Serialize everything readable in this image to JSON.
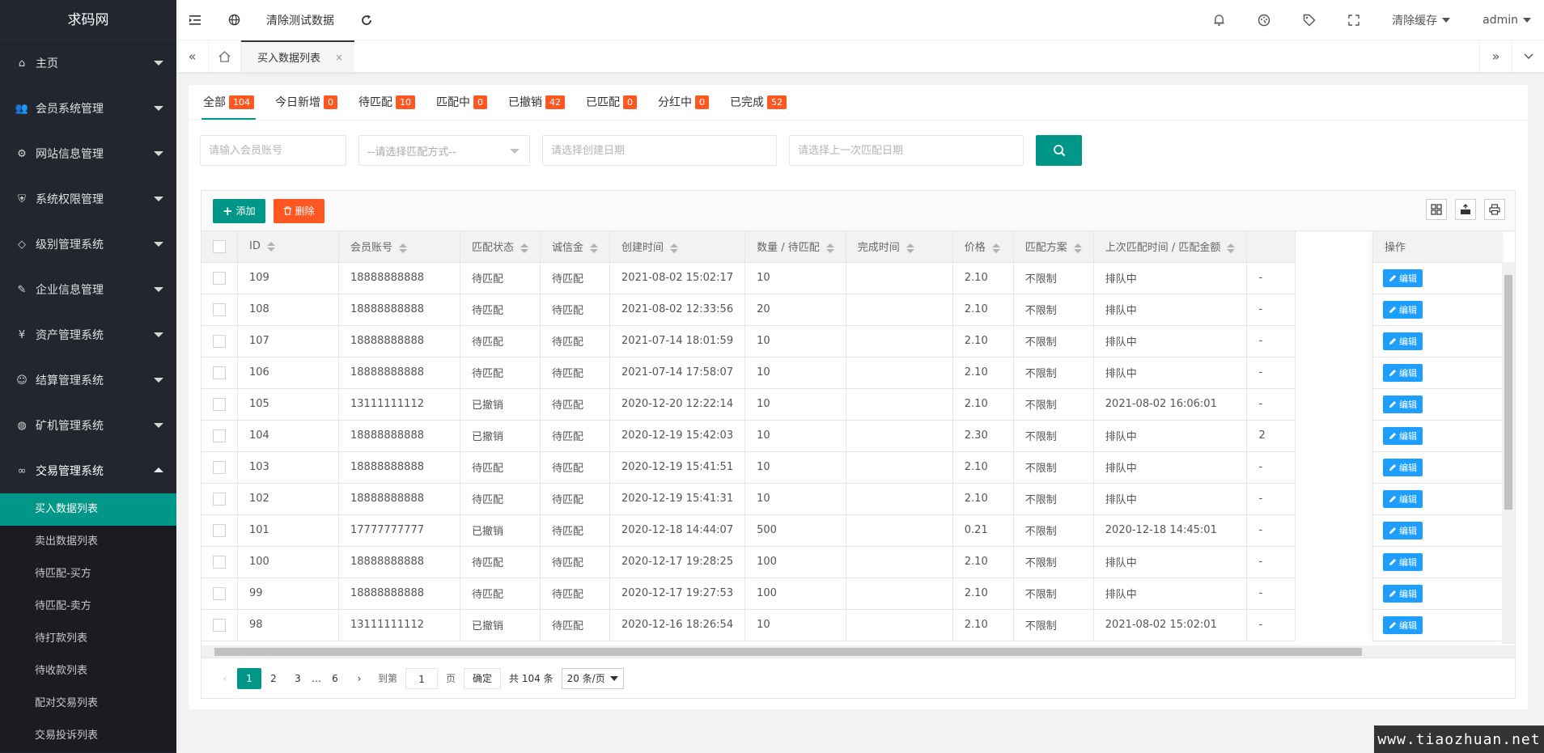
{
  "sidebar": {
    "logo": "求码网",
    "items": [
      {
        "label": "主页",
        "icon": "home-icon",
        "glyph": "⌂"
      },
      {
        "label": "会员系统管理",
        "icon": "users-icon",
        "glyph": "👥"
      },
      {
        "label": "网站信息管理",
        "icon": "gear-icon",
        "glyph": "⚙"
      },
      {
        "label": "系统权限管理",
        "icon": "shield-icon",
        "glyph": "⛨"
      },
      {
        "label": "级别管理系统",
        "icon": "diamond-icon",
        "glyph": "◇"
      },
      {
        "label": "企业信息管理",
        "icon": "file-edit-icon",
        "glyph": "✎"
      },
      {
        "label": "资产管理系统",
        "icon": "yen-icon",
        "glyph": "¥"
      },
      {
        "label": "结算管理系统",
        "icon": "smile-icon",
        "glyph": "☺"
      },
      {
        "label": "矿机管理系统",
        "icon": "globe-icon",
        "glyph": "◍"
      },
      {
        "label": "交易管理系统",
        "icon": "infinity-icon",
        "glyph": "∞"
      }
    ],
    "subitems": [
      "买入数据列表",
      "卖出数据列表",
      "待匹配-买方",
      "待匹配-卖方",
      "待打款列表",
      "待收款列表",
      "配对交易列表",
      "交易投诉列表"
    ]
  },
  "header": {
    "clear_test_data": "清除测试数据",
    "clear_cache": "清除缓存",
    "user": "admin"
  },
  "tabsbar": {
    "active_tab": "买入数据列表",
    "close": "×"
  },
  "status_tabs": [
    {
      "label": "全部",
      "count": "104"
    },
    {
      "label": "今日新增",
      "count": "0"
    },
    {
      "label": "待匹配",
      "count": "10"
    },
    {
      "label": "匹配中",
      "count": "0"
    },
    {
      "label": "已撤销",
      "count": "42"
    },
    {
      "label": "已匹配",
      "count": "0"
    },
    {
      "label": "分红中",
      "count": "0"
    },
    {
      "label": "已完成",
      "count": "52"
    }
  ],
  "filters": {
    "account_placeholder": "请输入会员账号",
    "match_method_placeholder": "--请选择匹配方式--",
    "create_date_placeholder": "请选择创建日期",
    "last_match_date_placeholder": "请选择上一次匹配日期"
  },
  "toolbar": {
    "add_label": "添加",
    "delete_label": "删除"
  },
  "table": {
    "columns": [
      "ID",
      "会员账号",
      "匹配状态",
      "诚信金",
      "创建时间",
      "数量 / 待匹配",
      "完成时间",
      "价格",
      "匹配方案",
      "上次匹配时间 / 匹配金额",
      "操作"
    ],
    "edit_label": "编辑",
    "rows": [
      [
        "109",
        "18888888888",
        "待匹配",
        "待匹配",
        "2021-08-02 15:02:17",
        "10",
        "",
        "2.10",
        "不限制",
        "排队中",
        "-"
      ],
      [
        "108",
        "18888888888",
        "待匹配",
        "待匹配",
        "2021-08-02 12:33:56",
        "20",
        "",
        "2.10",
        "不限制",
        "排队中",
        "-"
      ],
      [
        "107",
        "18888888888",
        "待匹配",
        "待匹配",
        "2021-07-14 18:01:59",
        "10",
        "",
        "2.10",
        "不限制",
        "排队中",
        "-"
      ],
      [
        "106",
        "18888888888",
        "待匹配",
        "待匹配",
        "2021-07-14 17:58:07",
        "10",
        "",
        "2.10",
        "不限制",
        "排队中",
        "-"
      ],
      [
        "105",
        "13111111112",
        "已撤销",
        "待匹配",
        "2020-12-20 12:22:14",
        "10",
        "",
        "2.10",
        "不限制",
        "2021-08-02 16:06:01",
        "-"
      ],
      [
        "104",
        "18888888888",
        "已撤销",
        "待匹配",
        "2020-12-19 15:42:03",
        "10",
        "",
        "2.30",
        "不限制",
        "排队中",
        "2"
      ],
      [
        "103",
        "18888888888",
        "待匹配",
        "待匹配",
        "2020-12-19 15:41:51",
        "10",
        "",
        "2.10",
        "不限制",
        "排队中",
        "-"
      ],
      [
        "102",
        "18888888888",
        "待匹配",
        "待匹配",
        "2020-12-19 15:41:31",
        "10",
        "",
        "2.10",
        "不限制",
        "排队中",
        "-"
      ],
      [
        "101",
        "17777777777",
        "已撤销",
        "待匹配",
        "2020-12-18 14:44:07",
        "500",
        "",
        "0.21",
        "不限制",
        "2020-12-18 14:45:01",
        "-"
      ],
      [
        "100",
        "18888888888",
        "待匹配",
        "待匹配",
        "2020-12-17 19:28:25",
        "100",
        "",
        "2.10",
        "不限制",
        "排队中",
        "-"
      ],
      [
        "99",
        "18888888888",
        "待匹配",
        "待匹配",
        "2020-12-17 19:27:53",
        "100",
        "",
        "2.10",
        "不限制",
        "排队中",
        "-"
      ],
      [
        "98",
        "13111111112",
        "已撤销",
        "待匹配",
        "2020-12-16 18:26:54",
        "10",
        "",
        "2.10",
        "不限制",
        "2021-08-02 15:02:01",
        "-"
      ]
    ]
  },
  "pager": {
    "pages": [
      "1",
      "2",
      "3",
      "…",
      "6"
    ],
    "goto_label": "到第",
    "goto_value": "1",
    "page_unit": "页",
    "confirm": "确定",
    "total": "共 104 条",
    "per_page": "20 条/页"
  },
  "watermark": "www.tiaozhuan.net",
  "colors": {
    "accent": "#009688",
    "danger": "#ff5722",
    "info": "#1e9fff",
    "sidebar": "#23262e"
  }
}
